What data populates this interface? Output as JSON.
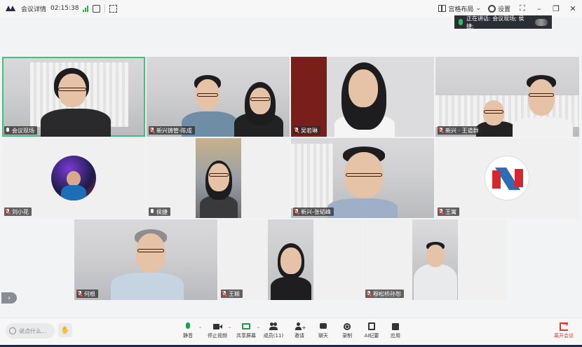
{
  "topbar": {
    "meeting_info": "会议详情",
    "timer": "02:15:38",
    "layout_label": "宫格布局",
    "settings_label": "设置"
  },
  "speaking": {
    "text": "正在讲话:  会议现场; 侯捷;"
  },
  "tiles": [
    {
      "name": "会议现场"
    },
    {
      "name": "新兴铸管-陈成"
    },
    {
      "name": "吴若琳"
    },
    {
      "name": "新兴 · 王道群"
    },
    {
      "name": "刘小花"
    },
    {
      "name": "侯捷"
    },
    {
      "name": "新兴-张韬峰"
    },
    {
      "name": "王寓"
    },
    {
      "name": "何根"
    },
    {
      "name": "王颖"
    },
    {
      "name": "穆松桥孙恕"
    }
  ],
  "bottombar": {
    "chat_placeholder": "说点什么...",
    "tools": {
      "mute": "静音",
      "stop_video": "停止视频",
      "share": "共享屏幕",
      "members": "成员(11)",
      "invite": "邀请",
      "chat": "聊天",
      "record": "录制",
      "ai_minutes": "AI纪要",
      "apps": "应用"
    },
    "leave": "离开会议"
  },
  "colors": {
    "active_speaker_border": "#41c27a",
    "leave_red": "#e0392e",
    "signal_green": "#2bb14a"
  }
}
